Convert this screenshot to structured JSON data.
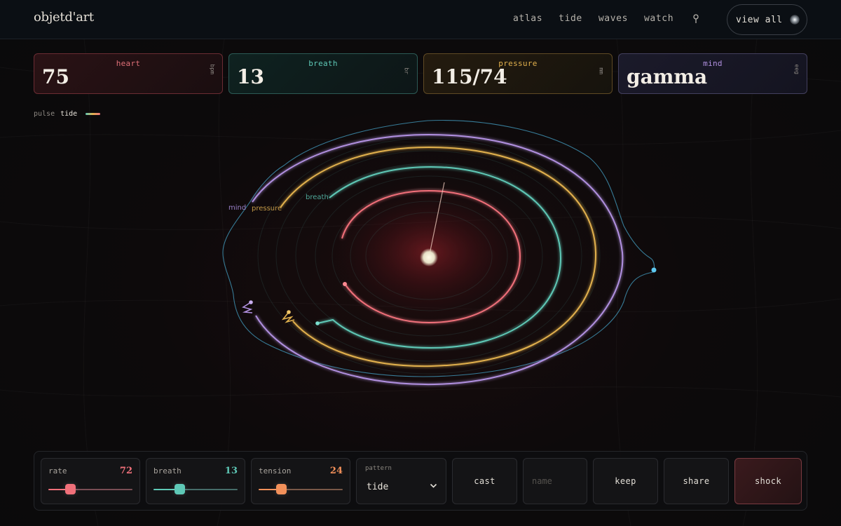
{
  "brand": {
    "logo": "objetd'art"
  },
  "nav": {
    "items": [
      "atlas",
      "tide",
      "waves",
      "watch"
    ],
    "view_all": "view all"
  },
  "stats": {
    "heart": {
      "label": "heart",
      "value": "75",
      "unit": "bpm",
      "color": "#f0707a"
    },
    "breath": {
      "label": "breath",
      "value": "13",
      "unit": "br",
      "color": "#5ec8b6"
    },
    "pressure": {
      "label": "pressure",
      "value": "115/74",
      "unit": "mm",
      "color": "#e2b14e"
    },
    "mind": {
      "label": "mind",
      "value": "gamma",
      "unit": "eeg",
      "color": "#b190e0"
    }
  },
  "view_toggle": {
    "options": [
      "pulse",
      "tide"
    ],
    "active": "tide"
  },
  "viz": {
    "ring_labels": {
      "mind": "mind",
      "pressure": "pressure",
      "breath": "breath"
    },
    "colors": {
      "heart": "#f0707a",
      "breath": "#5ec8b6",
      "pressure": "#e2b14e",
      "mind": "#b190e0",
      "outline": "#3e8fb0"
    }
  },
  "controls": {
    "rate": {
      "label": "rate",
      "value": "72",
      "level": 0.26,
      "color": "#f0707a"
    },
    "breath": {
      "label": "breath",
      "value": "13",
      "level": 0.31,
      "color": "#5ec8b6"
    },
    "tension": {
      "label": "tension",
      "value": "24",
      "level": 0.27,
      "color": "#f2905a"
    },
    "pattern": {
      "label": "pattern",
      "value": "tide"
    },
    "cast": "cast",
    "name_placeholder": "name",
    "keep": "keep",
    "share": "share",
    "shock": "shock"
  }
}
